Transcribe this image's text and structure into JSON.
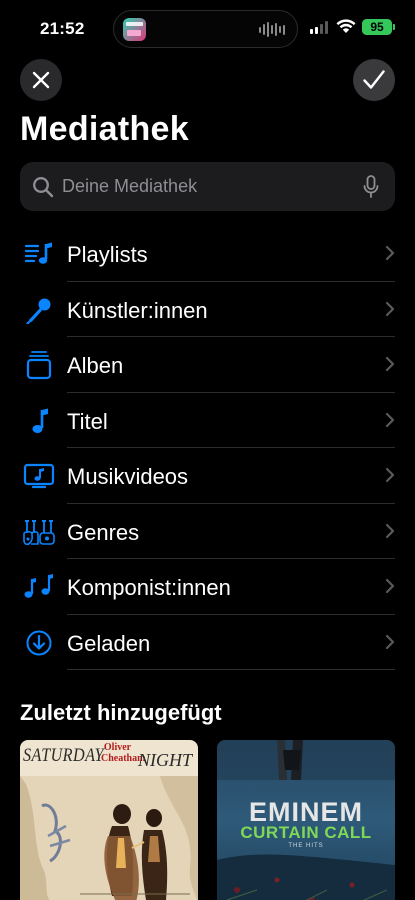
{
  "status_bar": {
    "time": "21:52",
    "battery": "95"
  },
  "nav": {
    "title": "Mediathek"
  },
  "search": {
    "placeholder": "Deine Mediathek"
  },
  "library_items": [
    {
      "label": "Playlists",
      "icon": "playlist-icon"
    },
    {
      "label": "Künstler:innen",
      "icon": "microphone-icon"
    },
    {
      "label": "Alben",
      "icon": "album-stack-icon"
    },
    {
      "label": "Titel",
      "icon": "music-note-icon"
    },
    {
      "label": "Musikvideos",
      "icon": "music-video-icon"
    },
    {
      "label": "Genres",
      "icon": "genres-icon"
    },
    {
      "label": "Komponist:innen",
      "icon": "composer-icon"
    },
    {
      "label": "Geladen",
      "icon": "download-icon"
    }
  ],
  "recently_added": {
    "title": "Zuletzt hinzugefügt",
    "albums": [
      {
        "cover_text_left": "SATURDAY",
        "cover_text_right": "NIGHT",
        "cover_artist": "Oliver Cheatham"
      },
      {
        "cover_artist": "EMINEM",
        "cover_title": "CURTAIN CALL",
        "cover_subtitle": "THE HITS"
      }
    ]
  },
  "colors": {
    "accent": "#0a84ff",
    "background": "#000000",
    "battery": "#34c759"
  }
}
